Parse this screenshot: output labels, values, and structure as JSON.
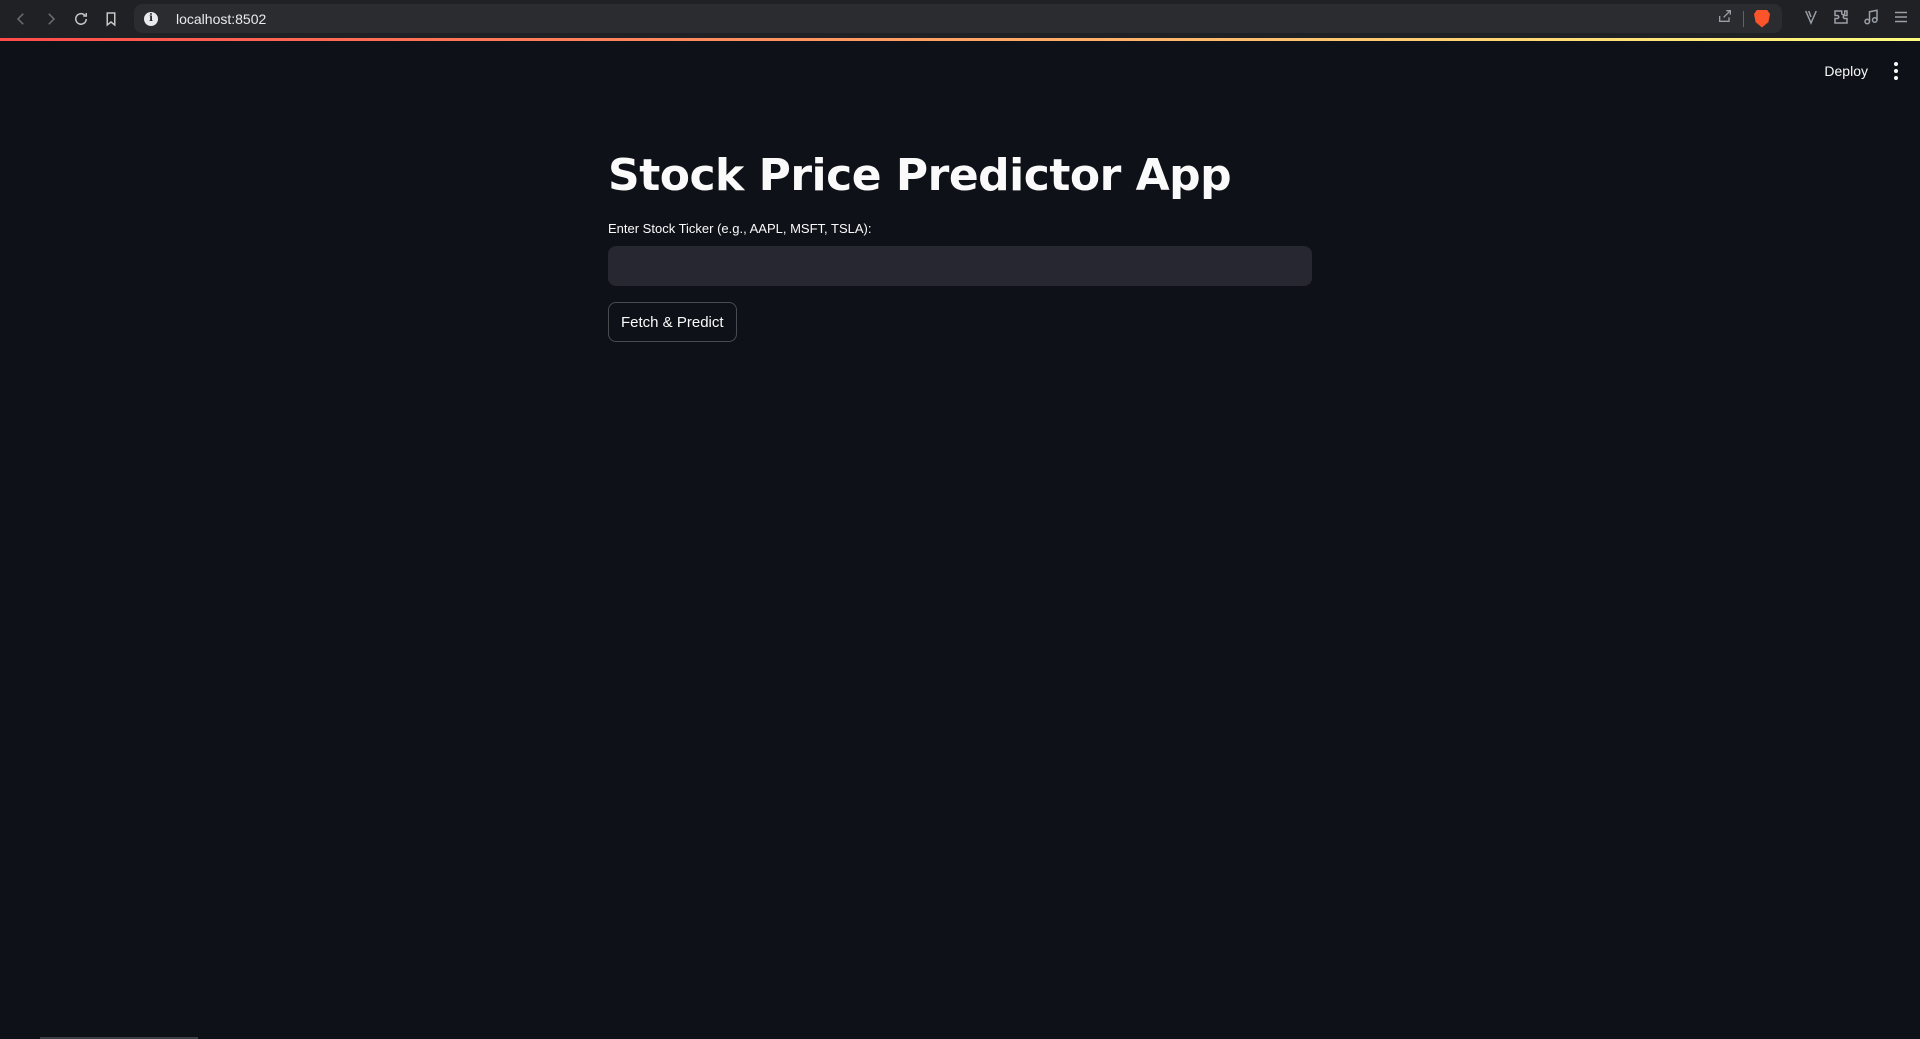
{
  "browser": {
    "url": "localhost:8502",
    "icons": [
      "back-icon",
      "forward-icon",
      "reload-icon",
      "bookmark-icon",
      "site-info-icon",
      "share-icon",
      "brave-shields-icon",
      "vpn-icon",
      "extensions-icon",
      "media-icon",
      "menu-icon"
    ]
  },
  "header": {
    "deploy_label": "Deploy",
    "decoration_colors": [
      "#ff4b4b",
      "#fffd80"
    ]
  },
  "main": {
    "title": "Stock Price Predictor App",
    "ticker_label": "Enter Stock Ticker (e.g., AAPL, MSFT, TSLA):",
    "ticker_value": "",
    "button_label": "Fetch & Predict"
  },
  "colors": {
    "background": "#0e1117",
    "input_background": "#262730",
    "text": "#fafafa"
  }
}
